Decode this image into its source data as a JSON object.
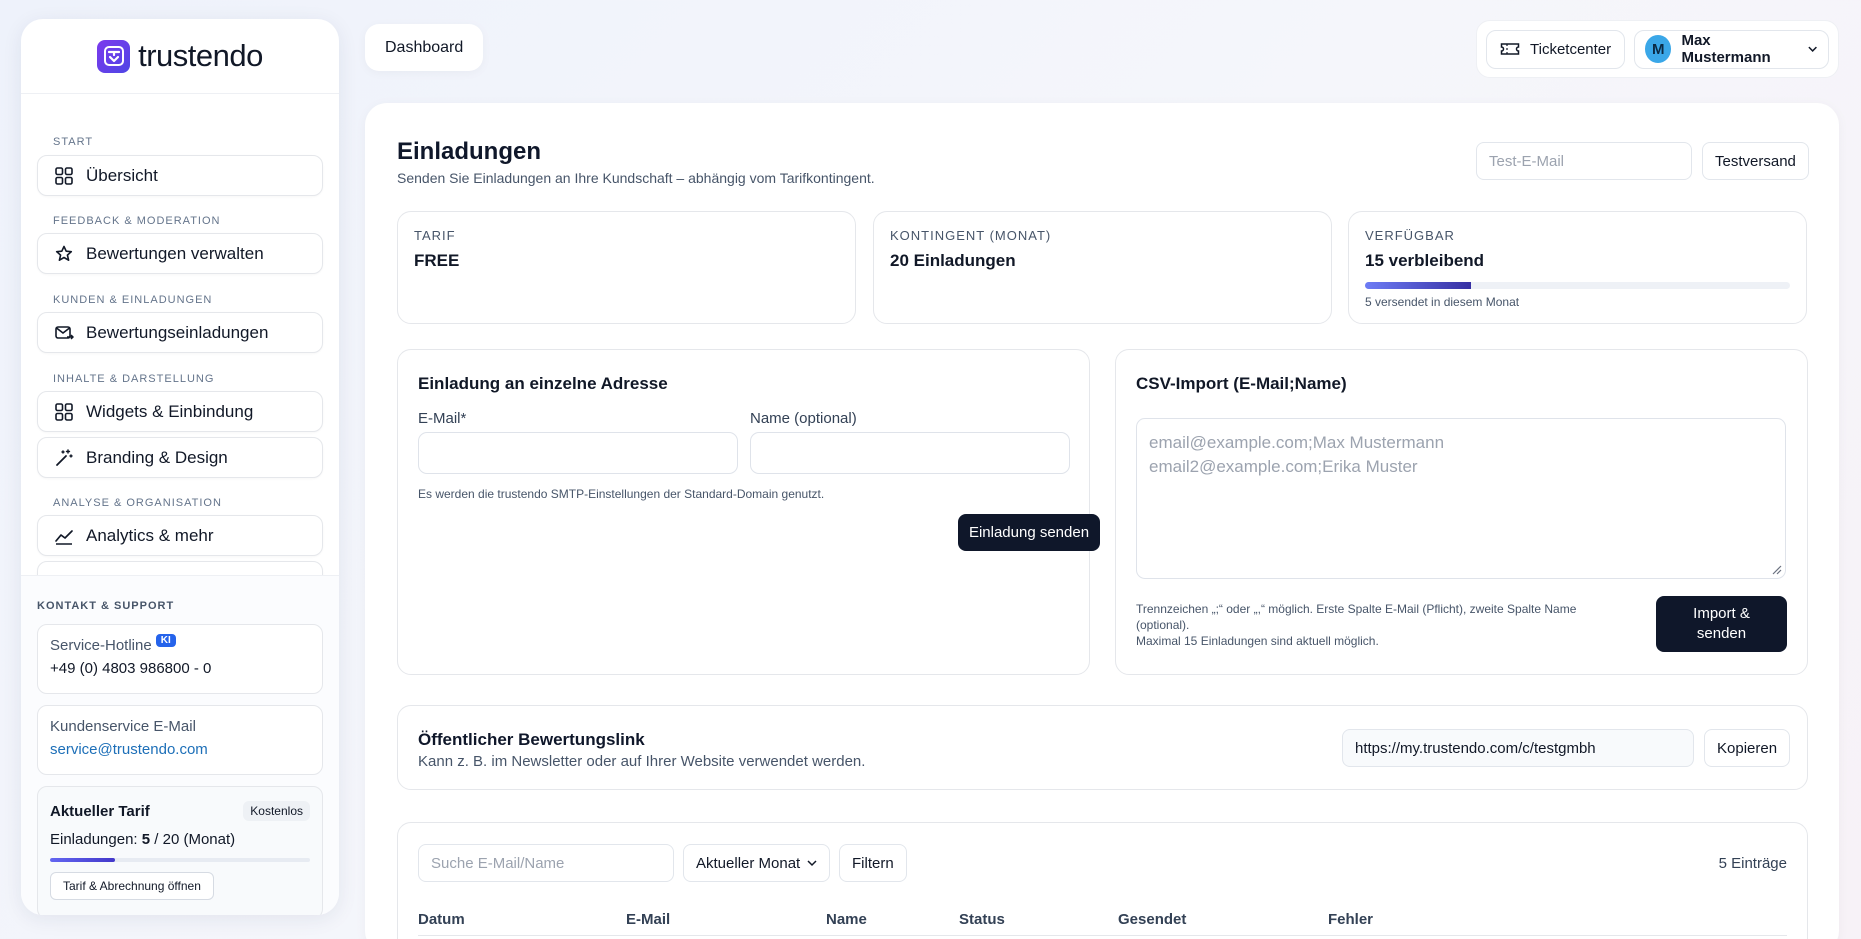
{
  "app": {
    "logo_text": "trustendo"
  },
  "sidebar": {
    "sections": [
      {
        "title": "Start",
        "items": [
          {
            "label": "Übersicht",
            "icon": "grid-icon"
          }
        ]
      },
      {
        "title": "Feedback & Moderation",
        "items": [
          {
            "label": "Bewertungen verwalten",
            "icon": "star-icon"
          }
        ]
      },
      {
        "title": "Kunden & Einladungen",
        "items": [
          {
            "label": "Bewertungseinladungen",
            "icon": "mail-send-icon"
          }
        ]
      },
      {
        "title": "Inhalte & Darstellung",
        "items": [
          {
            "label": "Widgets & Einbindung",
            "icon": "widgets-icon"
          },
          {
            "label": "Branding & Design",
            "icon": "magic-wand-icon"
          }
        ]
      },
      {
        "title": "Analyse & Organisation",
        "items": [
          {
            "label": "Analytics & mehr",
            "icon": "chart-line-icon"
          }
        ]
      }
    ],
    "contact": {
      "title": "Kontakt & Support",
      "hotline_label": "Service-Hotline",
      "hotline_badge": "KI",
      "hotline_value": "+49 (0) 4803 986800 - 0",
      "email_label": "Kundenservice E-Mail",
      "email_value": "service@trustendo.com"
    },
    "tarif": {
      "title": "Aktueller Tarif",
      "badge": "Kostenlos",
      "line_prefix": "Einladungen: ",
      "used": "5",
      "line_suffix": " / 20 (Monat)",
      "usage_fraction": 0.25,
      "button": "Tarif & Abrechnung öffnen"
    }
  },
  "header": {
    "tab": "Dashboard",
    "ticketcenter": "Ticketcenter",
    "user_initial": "M",
    "user_name": "Max Mustermann"
  },
  "main": {
    "title": "Einladungen",
    "subtitle": "Senden Sie Einladungen an Ihre Kundschaft – abhängig vom Tarifkontingent.",
    "test_email_placeholder": "Test-E-Mail",
    "test_button": "Testversand",
    "stats": [
      {
        "label": "Tarif",
        "value": "FREE"
      },
      {
        "label": "Kontingent (Monat)",
        "value": "20 Einladungen"
      },
      {
        "label": "Verfügbar",
        "value": "15 verbleibend",
        "progress_fraction": 0.25,
        "note": "5 versendet in diesem Monat"
      }
    ],
    "single": {
      "title": "Einladung an einzelne Adresse",
      "email_label": "E-Mail*",
      "name_label": "Name (optional)",
      "hint": "Es werden die trustendo SMTP-Einstellungen der Standard-Domain genutzt.",
      "button": "Einladung senden"
    },
    "csv": {
      "title": "CSV-Import (E-Mail;Name)",
      "placeholder_line1": "email@example.com;Max Mustermann",
      "placeholder_line2": "email2@example.com;Erika Muster",
      "hint1": "Trennzeichen „;“ oder „,“ möglich. Erste Spalte E-Mail (Pflicht), zweite Spalte Name (optional).",
      "hint2": "Maximal 15 Einladungen sind aktuell möglich.",
      "button": "Import & senden"
    },
    "public_link": {
      "title": "Öffentlicher Bewertungslink",
      "subtitle": "Kann z. B. im Newsletter oder auf Ihrer Website verwendet werden.",
      "url": "https://my.trustendo.com/c/testgmbh",
      "copy_button": "Kopieren"
    },
    "table": {
      "search_placeholder": "Suche E-Mail/Name",
      "period": "Aktueller Monat",
      "filter_button": "Filtern",
      "entries": "5 Einträge",
      "columns": [
        "Datum",
        "E-Mail",
        "Name",
        "Status",
        "Gesendet",
        "Fehler"
      ]
    }
  },
  "colors": {
    "accent": "#4f46e5",
    "dark_button": "#0f172a",
    "link": "#1d6fb8"
  }
}
